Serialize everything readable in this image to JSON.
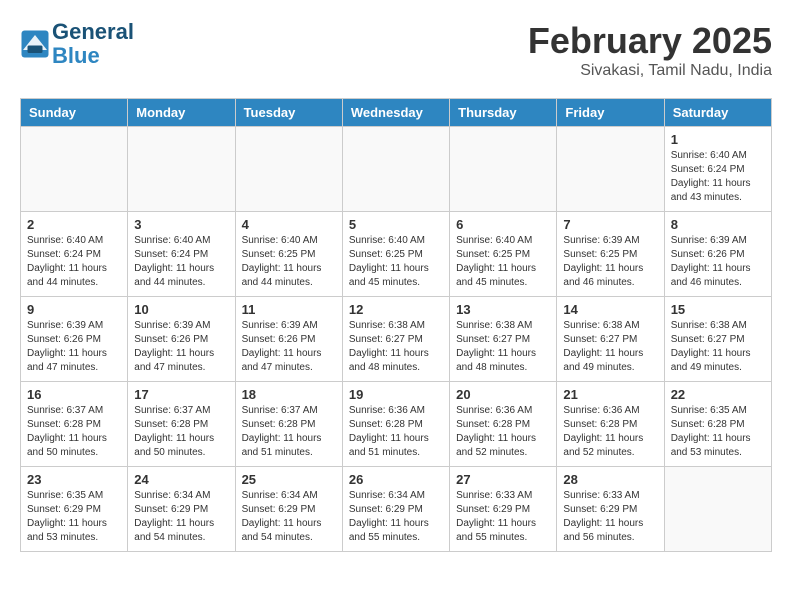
{
  "logo": {
    "line1": "General",
    "line2": "Blue"
  },
  "header": {
    "title": "February 2025",
    "subtitle": "Sivakasi, Tamil Nadu, India"
  },
  "weekdays": [
    "Sunday",
    "Monday",
    "Tuesday",
    "Wednesday",
    "Thursday",
    "Friday",
    "Saturday"
  ],
  "weeks": [
    [
      {
        "day": "",
        "info": ""
      },
      {
        "day": "",
        "info": ""
      },
      {
        "day": "",
        "info": ""
      },
      {
        "day": "",
        "info": ""
      },
      {
        "day": "",
        "info": ""
      },
      {
        "day": "",
        "info": ""
      },
      {
        "day": "1",
        "info": "Sunrise: 6:40 AM\nSunset: 6:24 PM\nDaylight: 11 hours\nand 43 minutes."
      }
    ],
    [
      {
        "day": "2",
        "info": "Sunrise: 6:40 AM\nSunset: 6:24 PM\nDaylight: 11 hours\nand 44 minutes."
      },
      {
        "day": "3",
        "info": "Sunrise: 6:40 AM\nSunset: 6:24 PM\nDaylight: 11 hours\nand 44 minutes."
      },
      {
        "day": "4",
        "info": "Sunrise: 6:40 AM\nSunset: 6:25 PM\nDaylight: 11 hours\nand 44 minutes."
      },
      {
        "day": "5",
        "info": "Sunrise: 6:40 AM\nSunset: 6:25 PM\nDaylight: 11 hours\nand 45 minutes."
      },
      {
        "day": "6",
        "info": "Sunrise: 6:40 AM\nSunset: 6:25 PM\nDaylight: 11 hours\nand 45 minutes."
      },
      {
        "day": "7",
        "info": "Sunrise: 6:39 AM\nSunset: 6:25 PM\nDaylight: 11 hours\nand 46 minutes."
      },
      {
        "day": "8",
        "info": "Sunrise: 6:39 AM\nSunset: 6:26 PM\nDaylight: 11 hours\nand 46 minutes."
      }
    ],
    [
      {
        "day": "9",
        "info": "Sunrise: 6:39 AM\nSunset: 6:26 PM\nDaylight: 11 hours\nand 47 minutes."
      },
      {
        "day": "10",
        "info": "Sunrise: 6:39 AM\nSunset: 6:26 PM\nDaylight: 11 hours\nand 47 minutes."
      },
      {
        "day": "11",
        "info": "Sunrise: 6:39 AM\nSunset: 6:26 PM\nDaylight: 11 hours\nand 47 minutes."
      },
      {
        "day": "12",
        "info": "Sunrise: 6:38 AM\nSunset: 6:27 PM\nDaylight: 11 hours\nand 48 minutes."
      },
      {
        "day": "13",
        "info": "Sunrise: 6:38 AM\nSunset: 6:27 PM\nDaylight: 11 hours\nand 48 minutes."
      },
      {
        "day": "14",
        "info": "Sunrise: 6:38 AM\nSunset: 6:27 PM\nDaylight: 11 hours\nand 49 minutes."
      },
      {
        "day": "15",
        "info": "Sunrise: 6:38 AM\nSunset: 6:27 PM\nDaylight: 11 hours\nand 49 minutes."
      }
    ],
    [
      {
        "day": "16",
        "info": "Sunrise: 6:37 AM\nSunset: 6:28 PM\nDaylight: 11 hours\nand 50 minutes."
      },
      {
        "day": "17",
        "info": "Sunrise: 6:37 AM\nSunset: 6:28 PM\nDaylight: 11 hours\nand 50 minutes."
      },
      {
        "day": "18",
        "info": "Sunrise: 6:37 AM\nSunset: 6:28 PM\nDaylight: 11 hours\nand 51 minutes."
      },
      {
        "day": "19",
        "info": "Sunrise: 6:36 AM\nSunset: 6:28 PM\nDaylight: 11 hours\nand 51 minutes."
      },
      {
        "day": "20",
        "info": "Sunrise: 6:36 AM\nSunset: 6:28 PM\nDaylight: 11 hours\nand 52 minutes."
      },
      {
        "day": "21",
        "info": "Sunrise: 6:36 AM\nSunset: 6:28 PM\nDaylight: 11 hours\nand 52 minutes."
      },
      {
        "day": "22",
        "info": "Sunrise: 6:35 AM\nSunset: 6:28 PM\nDaylight: 11 hours\nand 53 minutes."
      }
    ],
    [
      {
        "day": "23",
        "info": "Sunrise: 6:35 AM\nSunset: 6:29 PM\nDaylight: 11 hours\nand 53 minutes."
      },
      {
        "day": "24",
        "info": "Sunrise: 6:34 AM\nSunset: 6:29 PM\nDaylight: 11 hours\nand 54 minutes."
      },
      {
        "day": "25",
        "info": "Sunrise: 6:34 AM\nSunset: 6:29 PM\nDaylight: 11 hours\nand 54 minutes."
      },
      {
        "day": "26",
        "info": "Sunrise: 6:34 AM\nSunset: 6:29 PM\nDaylight: 11 hours\nand 55 minutes."
      },
      {
        "day": "27",
        "info": "Sunrise: 6:33 AM\nSunset: 6:29 PM\nDaylight: 11 hours\nand 55 minutes."
      },
      {
        "day": "28",
        "info": "Sunrise: 6:33 AM\nSunset: 6:29 PM\nDaylight: 11 hours\nand 56 minutes."
      },
      {
        "day": "",
        "info": ""
      }
    ]
  ]
}
